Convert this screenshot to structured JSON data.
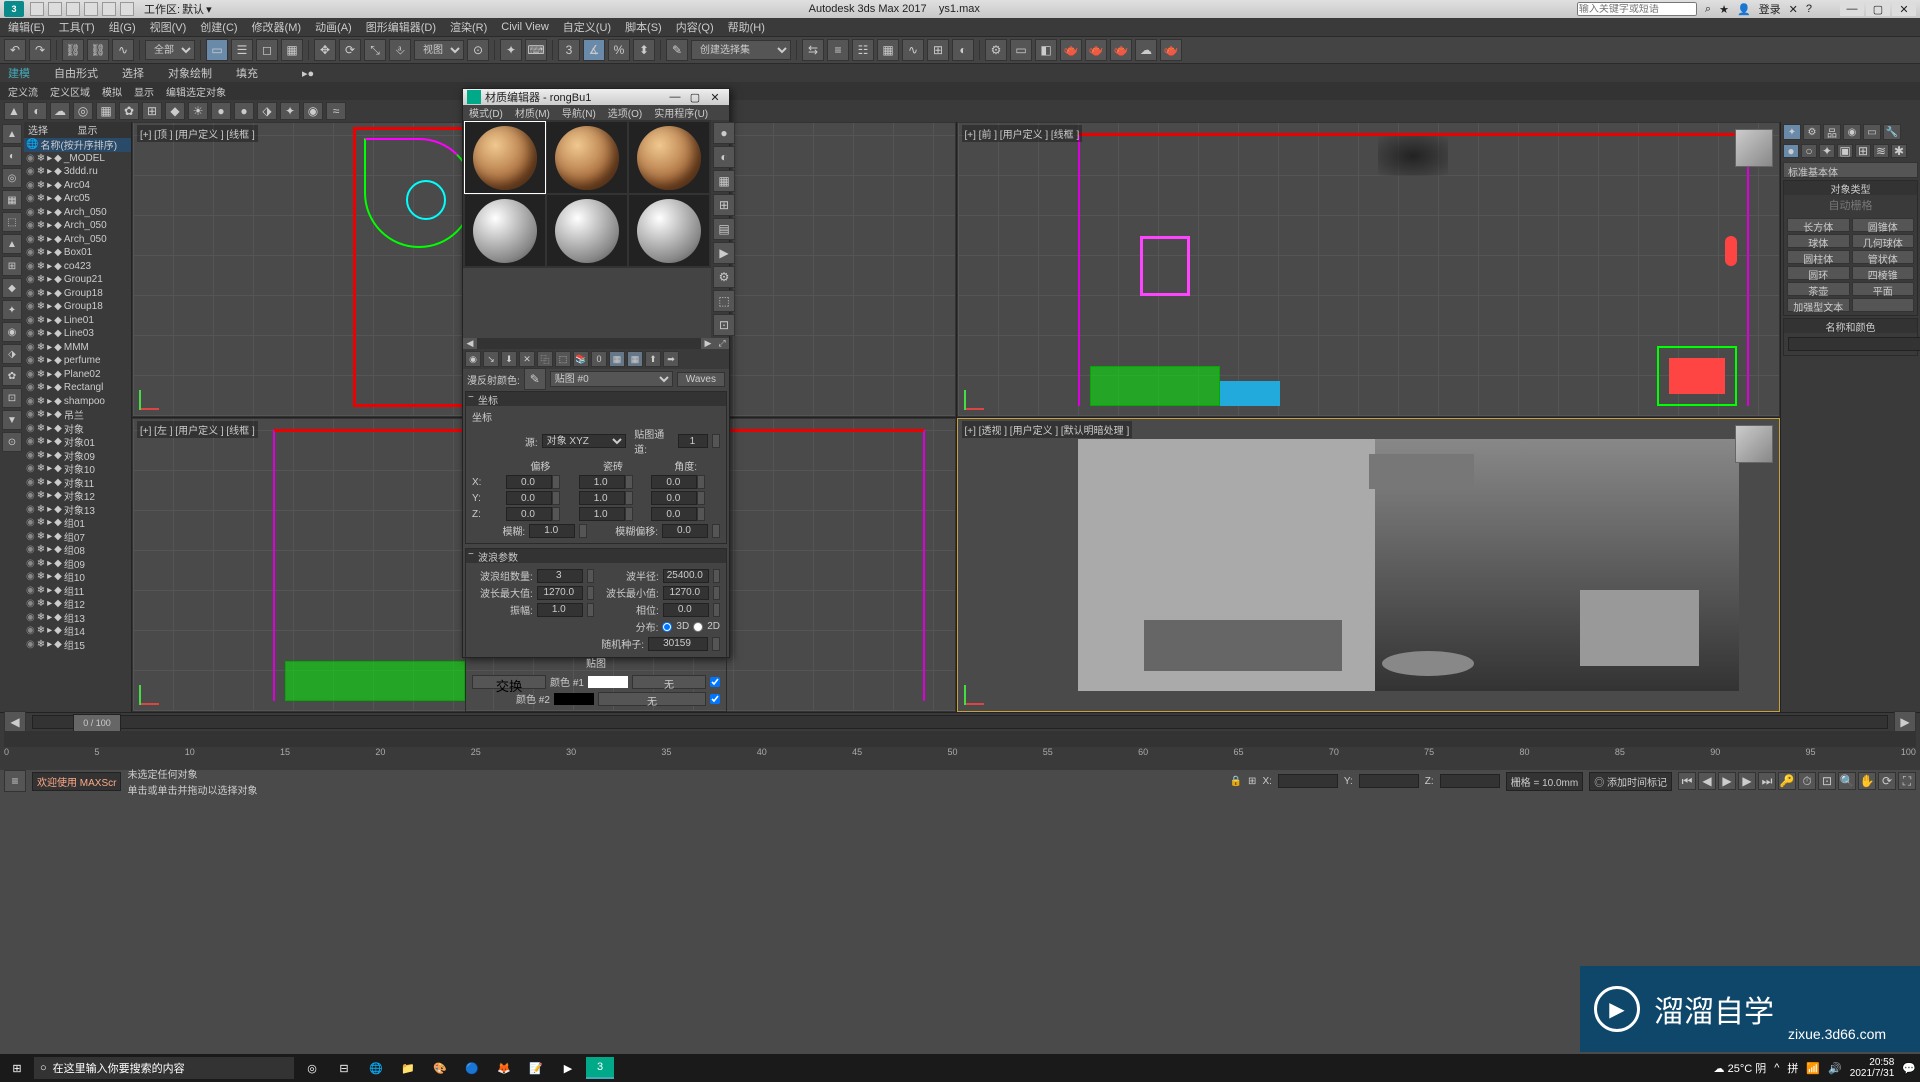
{
  "app": {
    "title": "Autodesk 3ds Max 2017",
    "file": "ys1.max",
    "workspace_label": "工作区:",
    "workspace_value": "默认",
    "search_placeholder": "输入关键字或短语",
    "login": "登录"
  },
  "menubar": [
    "编辑(E)",
    "工具(T)",
    "组(G)",
    "视图(V)",
    "创建(C)",
    "修改器(M)",
    "动画(A)",
    "图形编辑器(D)",
    "渲染(R)",
    "Civil View",
    "自定义(U)",
    "脚本(S)",
    "内容(Q)",
    "帮助(H)"
  ],
  "maintool": {
    "filter": "全部",
    "selset": "创建选择集"
  },
  "ribbon": {
    "tabs": [
      "建模",
      "自由形式",
      "选择",
      "对象绘制",
      "填充"
    ]
  },
  "subribbon": [
    "定义流",
    "定义区域",
    "模拟",
    "显示",
    "编辑选定对象"
  ],
  "explorer": {
    "cols": [
      "选择",
      "显示"
    ],
    "header": "名称(按升序排序)",
    "items": [
      "_MODEL",
      "3ddd.ru",
      "Arc04",
      "Arc05",
      "Arch_050",
      "Arch_050",
      "Arch_050",
      "Box01",
      "co423",
      "Group21",
      "Group18",
      "Group18",
      "Line01",
      "Line03",
      "MMM",
      "perfume",
      "Plane02",
      "Rectangl",
      "shampoo",
      "吊兰",
      "对象",
      "对象01",
      "对象09",
      "对象10",
      "对象11",
      "对象12",
      "对象13",
      "组01",
      "组07",
      "组08",
      "组09",
      "组10",
      "组11",
      "组12",
      "组13",
      "组14",
      "组15"
    ]
  },
  "viewports": {
    "vp1": "[+] [顶 ] [用户定义 ] [线框 ]",
    "vp2": "[+] [前 ] [用户定义 ] [线框 ]",
    "vp3": "[+] [左 ] [用户定义 ] [线框 ]",
    "vp4": "[+] [透视 ] [用户定义 ] [默认明暗处理 ]"
  },
  "cmdpanel": {
    "category": "标准基本体",
    "rollouts": {
      "type": "对象类型",
      "autogrid": "自动栅格",
      "buttons": [
        "长方体",
        "圆锥体",
        "球体",
        "几何球体",
        "圆柱体",
        "管状体",
        "圆环",
        "四棱锥",
        "茶壶",
        "平面",
        "加强型文本",
        ""
      ],
      "namecolor": "名称和颜色"
    }
  },
  "mateditor": {
    "title": "材质编辑器 - rongBu1",
    "menu": [
      "模式(D)",
      "材质(M)",
      "导航(N)",
      "选项(O)",
      "实用程序(U)"
    ],
    "toolbar_label": "漫反射颜色:",
    "map_name": "贴图 #0",
    "type_btn": "Waves",
    "coord": {
      "title": "坐标",
      "sub": "坐标",
      "src_label": "源:",
      "src": "对象 XYZ",
      "mapchan_label": "贴图通道:",
      "mapchan": "1",
      "cols": [
        "偏移",
        "瓷砖",
        "角度:"
      ],
      "rows": [
        {
          "axis": "X:",
          "off": "0.0",
          "tile": "1.0",
          "ang": "0.0"
        },
        {
          "axis": "Y:",
          "off": "0.0",
          "tile": "1.0",
          "ang": "0.0"
        },
        {
          "axis": "Z:",
          "off": "0.0",
          "tile": "1.0",
          "ang": "0.0"
        }
      ],
      "blur_label": "模糊:",
      "blur": "1.0",
      "bluroff_label": "模糊偏移:",
      "bluroff": "0.0"
    },
    "wave": {
      "title": "波浪参数",
      "numsets_label": "波浪组数量:",
      "numsets": "3",
      "radius_label": "波半径:",
      "radius": "25400.0",
      "maxlen_label": "波长最大值:",
      "maxlen": "1270.0",
      "minlen_label": "波长最小值:",
      "minlen": "1270.0",
      "amp_label": "振幅:",
      "amp": "1.0",
      "phase_label": "相位:",
      "phase": "0.0",
      "dist_label": "分布:",
      "d3": "3D",
      "d2": "2D",
      "seed_label": "随机种子:",
      "seed": "30159",
      "maps_title": "贴图",
      "col1_label": "颜色 #1",
      "col2_label": "颜色 #2",
      "swap": "交换",
      "none": "无"
    }
  },
  "timeline": {
    "frame_display": "0 / 100",
    "ticks": [
      "0",
      "5",
      "10",
      "15",
      "20",
      "25",
      "30",
      "35",
      "40",
      "45",
      "50",
      "55",
      "60",
      "65",
      "70",
      "75",
      "80",
      "85",
      "90",
      "95",
      "100"
    ],
    "prompt": "未选定任何对象",
    "welcome": "欢迎使用  MAXScr",
    "hint": "单击或单击并拖动以选择对象",
    "coords": {
      "xl": "X:",
      "yl": "Y:",
      "zl": "Z:"
    },
    "grid": "栅格 = 10.0mm",
    "autokey_off": "◎ 添加时间标记"
  },
  "watermark": {
    "brand": "溜溜自学",
    "url": "zixue.3d66.com"
  },
  "taskbar": {
    "search_placeholder": "在这里输入你要搜索的内容",
    "weather": "25°C 阴",
    "time": "20:58",
    "date": "2021/7/31"
  }
}
